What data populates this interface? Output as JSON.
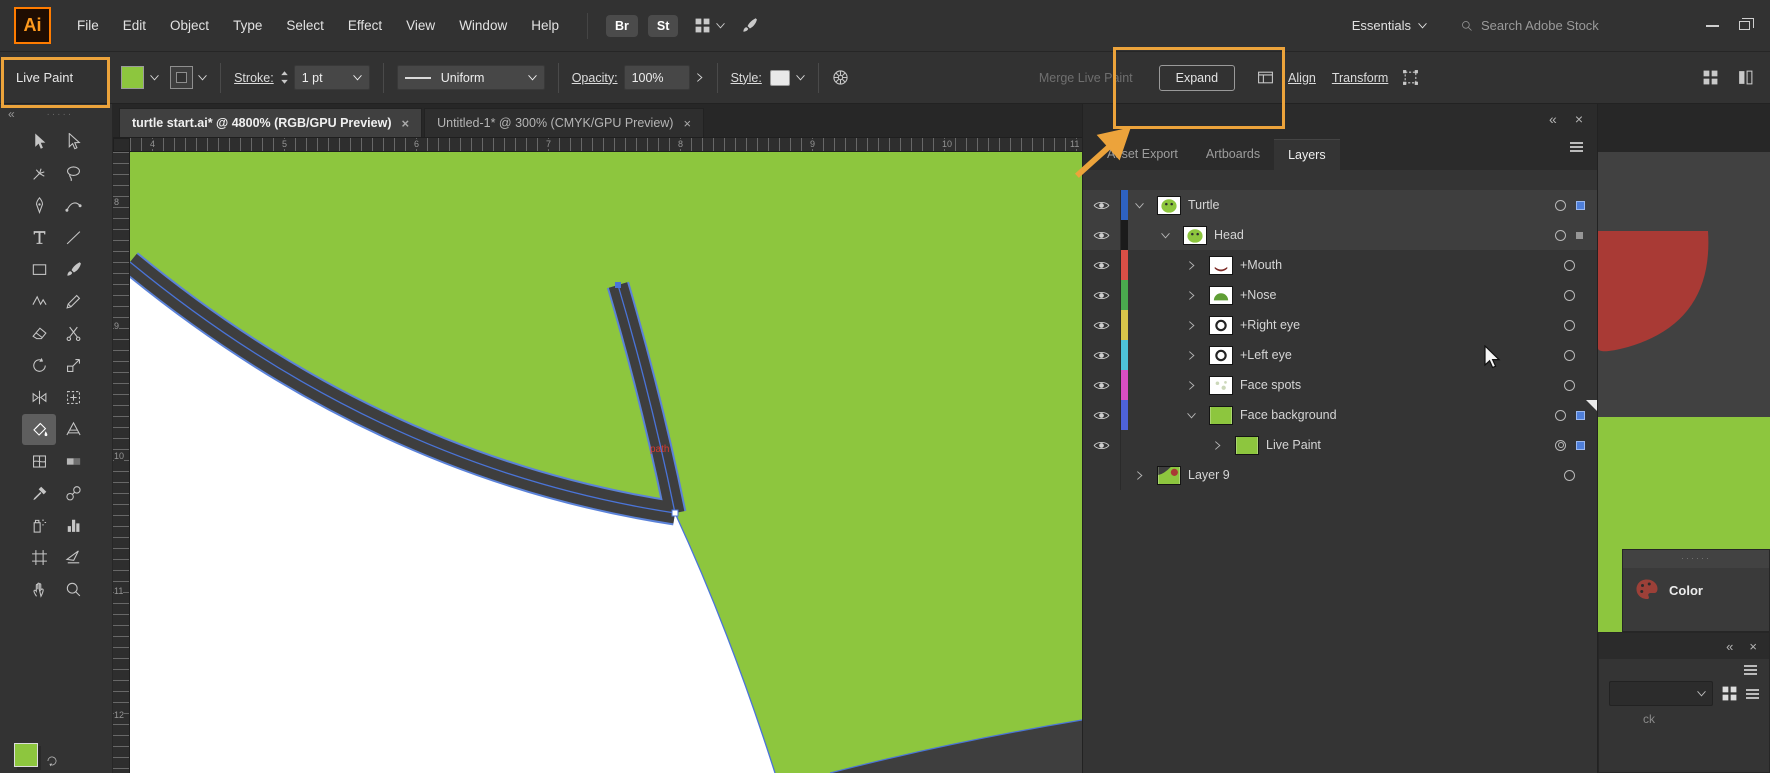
{
  "menubar": {
    "logo": "Ai",
    "menus": [
      "File",
      "Edit",
      "Object",
      "Type",
      "Select",
      "Effect",
      "View",
      "Window",
      "Help"
    ],
    "bridge_button": "Br",
    "stock_button": "St",
    "workspace": "Essentials",
    "search_placeholder": "Search Adobe Stock"
  },
  "control_bar": {
    "mode_label": "Live Paint",
    "stroke_label": "Stroke:",
    "stroke_weight": "1 pt",
    "width_profile": "Uniform",
    "opacity_label": "Opacity:",
    "opacity_value": "100%",
    "style_label": "Style:",
    "merge_button": "Merge Live Paint",
    "expand_button": "Expand",
    "align_link": "Align",
    "transform_link": "Transform"
  },
  "document_tabs": [
    {
      "title": "turtle start.ai* @ 4800% (RGB/GPU Preview)",
      "close": "×",
      "active": true
    },
    {
      "title": "Untitled-1* @ 300% (CMYK/GPU Preview)",
      "close": "×",
      "active": false
    }
  ],
  "toolbar_tools": [
    {
      "name": "selection-tool",
      "icon": "i-sel"
    },
    {
      "name": "direct-selection-tool",
      "icon": "i-dsel"
    },
    {
      "name": "magic-wand-tool",
      "icon": "i-wand"
    },
    {
      "name": "lasso-tool",
      "icon": "i-lasso"
    },
    {
      "name": "pen-tool",
      "icon": "i-pen"
    },
    {
      "name": "curvature-tool",
      "icon": "i-curv"
    },
    {
      "name": "type-tool",
      "icon": "i-type"
    },
    {
      "name": "line-segment-tool",
      "icon": "i-line"
    },
    {
      "name": "rectangle-tool",
      "icon": "i-rect"
    },
    {
      "name": "paintbrush-tool",
      "icon": "i-brush"
    },
    {
      "name": "shaper-tool",
      "icon": "i-shaper"
    },
    {
      "name": "pencil-tool",
      "icon": "i-pencil"
    },
    {
      "name": "eraser-tool",
      "icon": "i-eraser"
    },
    {
      "name": "scissors-tool",
      "icon": "i-scissors"
    },
    {
      "name": "rotate-tool",
      "icon": "i-rotate"
    },
    {
      "name": "scale-tool",
      "icon": "i-scale"
    },
    {
      "name": "width-tool",
      "icon": "i-width"
    },
    {
      "name": "free-transform-tool",
      "icon": "i-ftrans"
    },
    {
      "name": "live-paint-bucket-tool",
      "icon": "i-bucket",
      "selected": true
    },
    {
      "name": "perspective-grid-tool",
      "icon": "i-persp"
    },
    {
      "name": "mesh-tool",
      "icon": "i-mesh"
    },
    {
      "name": "gradient-tool",
      "icon": "i-grad"
    },
    {
      "name": "eyedropper-tool",
      "icon": "i-eyedrop"
    },
    {
      "name": "blend-tool",
      "icon": "i-blend"
    },
    {
      "name": "symbol-sprayer-tool",
      "icon": "i-spray"
    },
    {
      "name": "column-graph-tool",
      "icon": "i-graph"
    },
    {
      "name": "artboard-tool",
      "icon": "i-artboard"
    },
    {
      "name": "slice-tool",
      "icon": "i-slice"
    },
    {
      "name": "hand-tool",
      "icon": "i-hand"
    },
    {
      "name": "zoom-tool",
      "icon": "i-zoom"
    }
  ],
  "canvas": {
    "h_ruler_labels": [
      "4",
      "5",
      "6",
      "7",
      "8",
      "9",
      "10",
      "11"
    ],
    "v_ruler_labels": [
      "8",
      "9",
      "10",
      "11",
      "12"
    ],
    "path_label": "path",
    "artwork_green": "#8dc63e",
    "outline_dark": "#3e3e3e",
    "selection_blue": "#4a74d8",
    "label_red": "#d83a2e"
  },
  "layers_panel": {
    "tabs": [
      {
        "label": "Asset Export",
        "active": false
      },
      {
        "label": "Artboards",
        "active": false
      },
      {
        "label": "Layers",
        "active": true
      }
    ],
    "rows": [
      {
        "label": "Turtle",
        "indent": 0,
        "chevron": "open",
        "eye": true,
        "color": "#2e62c1",
        "thumb": "turtle",
        "target": "ring",
        "badge": "blue",
        "highlight": true
      },
      {
        "label": "Head",
        "indent": 1,
        "chevron": "open",
        "eye": true,
        "color": "#1b1b1b",
        "thumb": "turtle",
        "target": "ring",
        "badge": "gray",
        "highlight": true
      },
      {
        "label": "+Mouth",
        "indent": 2,
        "chevron": "closed",
        "eye": true,
        "color": "#d94f46",
        "thumb": "mouth",
        "target": "ring"
      },
      {
        "label": "+Nose",
        "indent": 2,
        "chevron": "closed",
        "eye": true,
        "color": "#4aa94e",
        "thumb": "nose",
        "target": "ring"
      },
      {
        "label": "+Right eye",
        "indent": 2,
        "chevron": "closed",
        "eye": true,
        "color": "#d8c64a",
        "thumb": "eye",
        "target": "ring"
      },
      {
        "label": "+Left eye",
        "indent": 2,
        "chevron": "closed",
        "eye": true,
        "color": "#4ec3d8",
        "thumb": "eye",
        "target": "ring"
      },
      {
        "label": "Face spots",
        "indent": 2,
        "chevron": "closed",
        "eye": true,
        "color": "#d84ec3",
        "thumb": "spots",
        "target": "ring"
      },
      {
        "label": "Face background",
        "indent": 2,
        "chevron": "open",
        "eye": true,
        "color": "#4e62d8",
        "thumb": "green",
        "target": "ring",
        "badge": "blue",
        "corner": true
      },
      {
        "label": "Live Paint",
        "indent": 3,
        "chevron": "closed",
        "eye": true,
        "color": null,
        "thumb": "green",
        "target": "double",
        "badge": "blue"
      },
      {
        "label": "Layer 9",
        "indent": 0,
        "chevron": "closed",
        "eye": false,
        "color": null,
        "thumb": "layer9",
        "target": "ring"
      }
    ]
  },
  "color_panel": {
    "title": "Color"
  },
  "bottom_right_panel": {
    "partial_text": "ck"
  },
  "annotations": {
    "highlight_color": "#eca33b"
  }
}
